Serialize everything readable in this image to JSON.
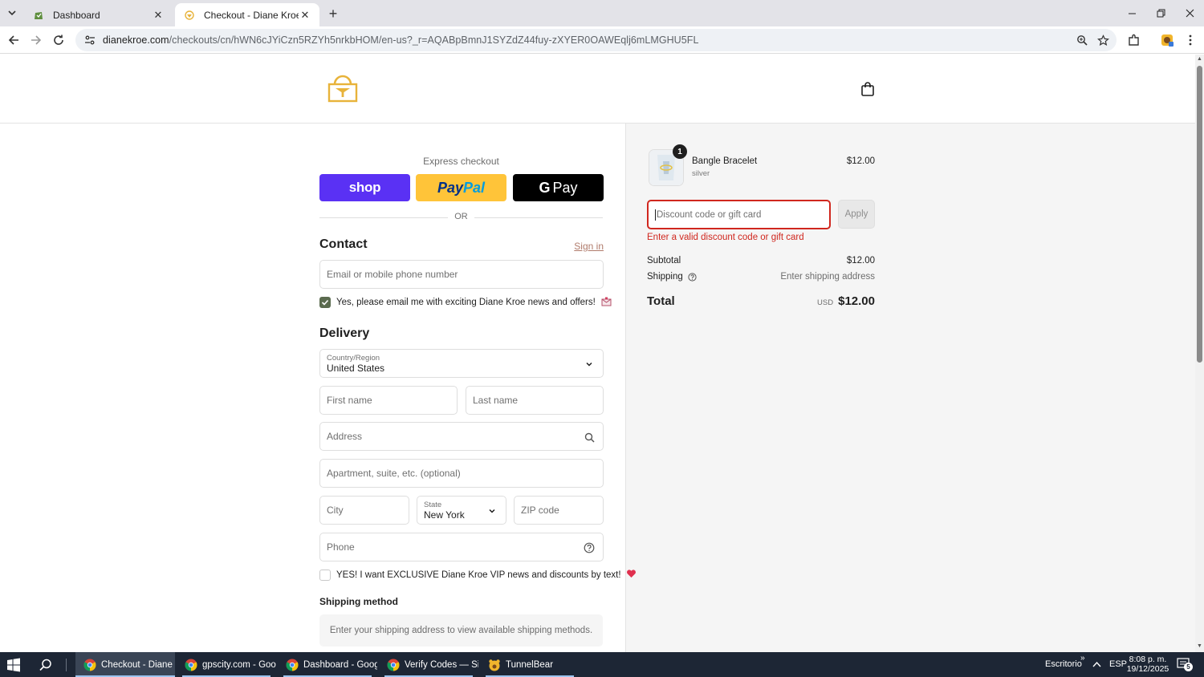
{
  "browser": {
    "tabs": [
      {
        "title": "Dashboard",
        "active": false
      },
      {
        "title": "Checkout - Diane Kroe",
        "active": true
      }
    ],
    "url_host": "dianekroe.com",
    "url_path": "/checkouts/cn/hWN6cJYiCzn5RZYh5nrkbHOM/en-us?_r=AQABpBmnJ1SYZdZ44fuy-zXYER0OAWEqlj6mLMGHU5FL"
  },
  "checkout": {
    "express_label": "Express checkout",
    "shop_label": "shop",
    "paypal_part1": "Pay",
    "paypal_part2": "Pal",
    "gpay_g": "G",
    "gpay_label": "Pay",
    "or_label": "OR",
    "contact_title": "Contact",
    "sign_in": "Sign in",
    "email_placeholder": "Email or mobile phone number",
    "email_optin": "Yes, please email me with exciting Diane Kroe news and offers!",
    "email_optin_checked": true,
    "delivery_title": "Delivery",
    "country_label": "Country/Region",
    "country_value": "United States",
    "first_name_placeholder": "First name",
    "last_name_placeholder": "Last name",
    "address_placeholder": "Address",
    "apartment_placeholder": "Apartment, suite, etc. (optional)",
    "city_placeholder": "City",
    "state_label": "State",
    "state_value": "New York",
    "zip_placeholder": "ZIP code",
    "phone_placeholder": "Phone",
    "sms_optin": "YES! I want EXCLUSIVE Diane Kroe VIP news and discounts by text!",
    "sms_optin_checked": false,
    "shipping_method_title": "Shipping method",
    "shipping_method_note": "Enter your shipping address to view available shipping methods."
  },
  "summary": {
    "product_name": "Bangle Bracelet",
    "product_variant": "silver",
    "product_price": "$12.00",
    "quantity": "1",
    "discount_placeholder": "Discount code or gift card",
    "apply_label": "Apply",
    "discount_error": "Enter a valid discount code or gift card",
    "subtotal_label": "Subtotal",
    "subtotal_value": "$12.00",
    "shipping_label": "Shipping",
    "shipping_value": "Enter shipping address",
    "total_label": "Total",
    "currency": "USD",
    "total_value": "$12.00"
  },
  "taskbar": {
    "items": [
      {
        "label": "Checkout - Diane K..."
      },
      {
        "label": "gpscity.com - Goo..."
      },
      {
        "label": "Dashboard - Googl..."
      },
      {
        "label": "Verify Codes — Sim..."
      },
      {
        "label": "TunnelBear"
      }
    ],
    "desktop_label": "Escritorio",
    "language": "ESP",
    "time": "8:08 p. m.",
    "date": "19/12/2025",
    "notification_count": "5"
  },
  "colors": {
    "shop_purple": "#5a31f4",
    "paypal_yellow": "#ffc439",
    "error_red": "#d0271e",
    "checkbox_green": "#5b6b4f",
    "link_brown": "#b07b6b"
  }
}
